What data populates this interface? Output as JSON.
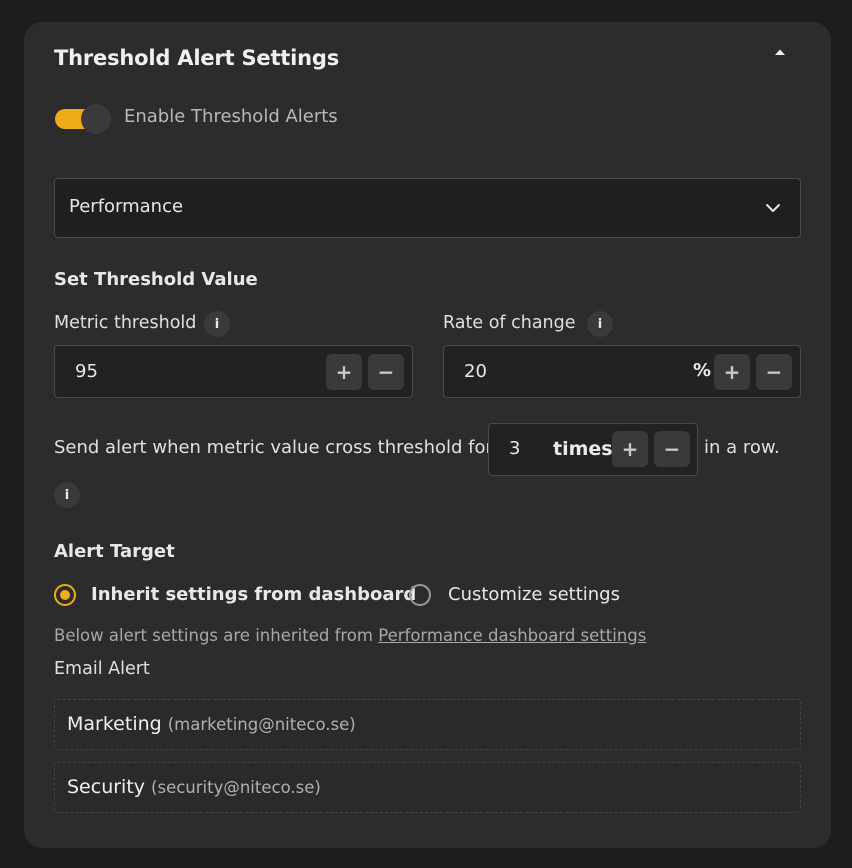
{
  "panel": {
    "title": "Threshold Alert Settings"
  },
  "toggle": {
    "label": "Enable Threshold Alerts",
    "on": true
  },
  "category_select": {
    "value": "Performance"
  },
  "threshold_section": {
    "heading": "Set Threshold Value",
    "metric": {
      "label": "Metric threshold",
      "value": "95"
    },
    "rate": {
      "label": "Rate of change",
      "value": "20",
      "unit": "%"
    },
    "plus_label": "+",
    "minus_label": "−"
  },
  "repeat": {
    "prefix": "Send alert when metric value cross threshold for",
    "value": "3",
    "unit": "times",
    "suffix": "in a row."
  },
  "info_label": "i",
  "alert_target": {
    "heading": "Alert Target",
    "options": [
      {
        "label": "Inherit settings from dashboard",
        "selected": true
      },
      {
        "label": "Customize settings",
        "selected": false
      }
    ],
    "note_prefix": "Below alert settings are inherited from",
    "note_link": "Performance dashboard settings",
    "email_heading": "Email Alert",
    "emails": [
      {
        "name": "Marketing",
        "address": "(marketing@niteco.se)"
      },
      {
        "name": "Security",
        "address": "(security@niteco.se)"
      }
    ]
  },
  "colors": {
    "accent": "#f0ac17",
    "panel_bg": "#2c2c2c",
    "page_bg": "#1d1d1d"
  }
}
